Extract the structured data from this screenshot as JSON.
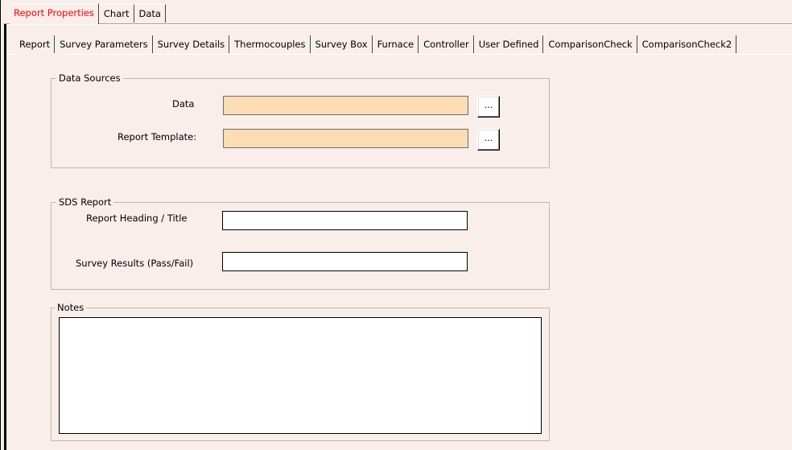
{
  "top_tabs": [
    {
      "label": "Report Properties",
      "active": true
    },
    {
      "label": "Chart",
      "active": false
    },
    {
      "label": "Data",
      "active": false
    }
  ],
  "sub_tabs": [
    {
      "label": "Report",
      "active": true
    },
    {
      "label": "Survey Parameters"
    },
    {
      "label": "Survey Details"
    },
    {
      "label": "Thermocouples"
    },
    {
      "label": "Survey Box"
    },
    {
      "label": "Furnace"
    },
    {
      "label": "Controller"
    },
    {
      "label": "User Defined"
    },
    {
      "label": "ComparisonCheck"
    },
    {
      "label": "ComparisonCheck2"
    }
  ],
  "data_sources": {
    "legend": "Data Sources",
    "data_label": "Data",
    "data_value": "",
    "template_label": "Report Template:",
    "template_value": "",
    "browse_label": "..."
  },
  "sds_report": {
    "legend": "SDS Report",
    "heading_label": "Report Heading / Title",
    "heading_value": "",
    "results_label": "Survey Results (Pass/Fail)",
    "results_value": ""
  },
  "notes": {
    "legend": "Notes",
    "value": ""
  },
  "colors": {
    "background": "#f9eeea",
    "active_tab_text": "#ff0000",
    "required_field": "#fcdcb4"
  }
}
